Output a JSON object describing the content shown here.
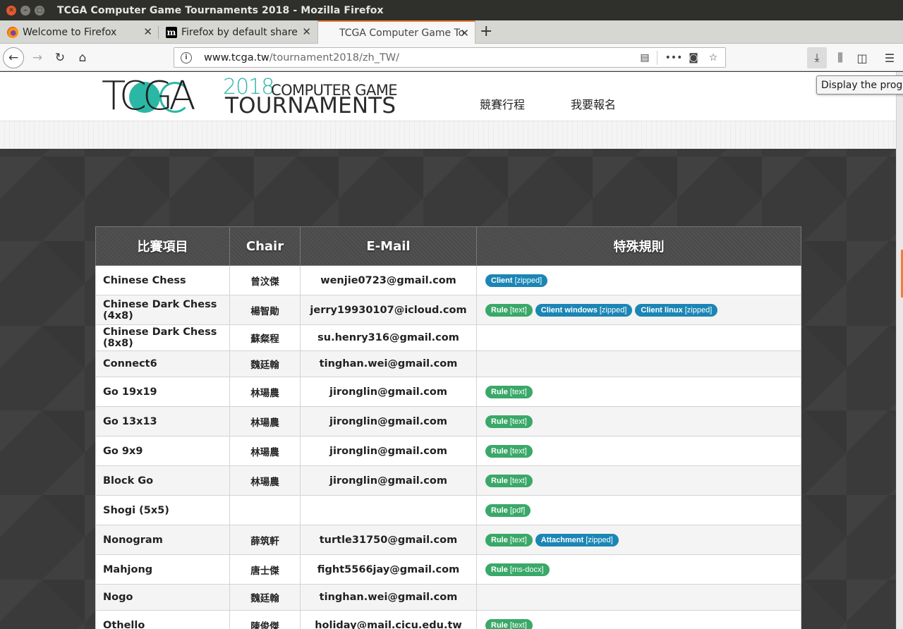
{
  "window": {
    "title": "TCGA Computer Game Tournaments 2018 - Mozilla Firefox"
  },
  "tabs": [
    {
      "label": "Welcome to Firefox",
      "icon": "firefox-icon"
    },
    {
      "label": "Firefox by default share",
      "icon": "medium-m-icon"
    },
    {
      "label": "TCGA Computer Game To",
      "icon": "none",
      "active": true
    }
  ],
  "nav": {
    "url_host": "www.tcga.tw",
    "url_path": "/tournament2018/zh_TW/"
  },
  "tooltip": "Display the progr",
  "site": {
    "logo": {
      "tcga": "TCGA",
      "year": "2018",
      "line1": "COMPUTER GAME",
      "line2": "TOURNAMENTS"
    },
    "menu": [
      "競賽行程",
      "我要報名"
    ]
  },
  "table": {
    "headers": [
      "比賽項目",
      "Chair",
      "E-Mail",
      "特殊規則"
    ],
    "rows": [
      {
        "event": "Chinese Chess",
        "chair": "曾汶傑",
        "email": "wenjie0723@gmail.com",
        "rules": [
          {
            "label": "Client",
            "meta": "[zipped]",
            "color": "blue"
          }
        ]
      },
      {
        "event": "Chinese Dark Chess (4x8)",
        "chair": "楊智勛",
        "email": "jerry19930107@icloud.com",
        "rules": [
          {
            "label": "Rule",
            "meta": "[text]",
            "color": "green"
          },
          {
            "label": "Client windows",
            "meta": "[zipped]",
            "color": "blue"
          },
          {
            "label": "Client linux",
            "meta": "[zipped]",
            "color": "blue"
          }
        ]
      },
      {
        "event": "Chinese Dark Chess (8x8)",
        "chair": "蘇粲程",
        "email": "su.henry316@gmail.com",
        "rules": []
      },
      {
        "event": "Connect6",
        "chair": "魏廷翰",
        "email": "tinghan.wei@gmail.com",
        "rules": []
      },
      {
        "event": "Go 19x19",
        "chair": "林瑒農",
        "email": "jironglin@gmail.com",
        "rules": [
          {
            "label": "Rule",
            "meta": "[text]",
            "color": "green"
          }
        ]
      },
      {
        "event": "Go 13x13",
        "chair": "林瑒農",
        "email": "jironglin@gmail.com",
        "rules": [
          {
            "label": "Rule",
            "meta": "[text]",
            "color": "green"
          }
        ]
      },
      {
        "event": "Go 9x9",
        "chair": "林瑒農",
        "email": "jironglin@gmail.com",
        "rules": [
          {
            "label": "Rule",
            "meta": "[text]",
            "color": "green"
          }
        ]
      },
      {
        "event": "Block Go",
        "chair": "林瑒農",
        "email": "jironglin@gmail.com",
        "rules": [
          {
            "label": "Rule",
            "meta": "[text]",
            "color": "green"
          }
        ]
      },
      {
        "event": "Shogi (5x5)",
        "chair": "",
        "email": "",
        "rules": [
          {
            "label": "Rule",
            "meta": "[pdf]",
            "color": "green"
          }
        ]
      },
      {
        "event": "Nonogram",
        "chair": "薛筑軒",
        "email": "turtle31750@gmail.com",
        "rules": [
          {
            "label": "Rule",
            "meta": "[text]",
            "color": "green"
          },
          {
            "label": "Attachment",
            "meta": "[zipped]",
            "color": "blue"
          }
        ]
      },
      {
        "event": "Mahjong",
        "chair": "唐士傑",
        "email": "fight5566jay@gmail.com",
        "rules": [
          {
            "label": "Rule",
            "meta": "[ms-docx]",
            "color": "green"
          }
        ]
      },
      {
        "event": "Nogo",
        "chair": "魏廷翰",
        "email": "tinghan.wei@gmail.com",
        "rules": []
      },
      {
        "event": "Othello",
        "chair": "陳俊傑",
        "email": "holiday@mail.cicu.edu.tw",
        "rules": [
          {
            "label": "Rule",
            "meta": "[text]",
            "color": "green"
          }
        ]
      }
    ]
  },
  "colors": {
    "accent": "#2bb7a6",
    "badge_green": "#3aa868",
    "badge_blue": "#1b86b5",
    "tab_highlight": "#f07e3a"
  }
}
